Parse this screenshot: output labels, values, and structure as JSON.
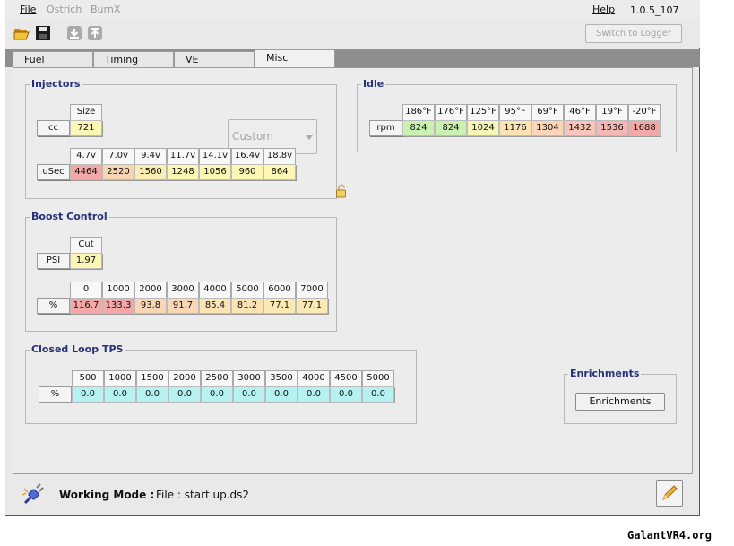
{
  "menubar": {
    "file": "File",
    "ostrich": "Ostrich",
    "burnx": "BurnX",
    "help": "Help",
    "version": "1.0.5_107"
  },
  "toolbar": {
    "switch_label": "Switch to Logger",
    "icons": [
      "open-folder-icon",
      "save-disk-icon",
      "download-icon",
      "upload-icon"
    ]
  },
  "tabs": [
    {
      "label": "Fuel",
      "active": false
    },
    {
      "label": "Timing",
      "active": false
    },
    {
      "label": "VE",
      "active": false
    },
    {
      "label": "Misc",
      "active": true
    }
  ],
  "injectors": {
    "title": "Injectors",
    "size_header": "Size",
    "cc_label": "cc",
    "size_value": "721",
    "dropdown_value": "Custom",
    "usec_label": "uSec",
    "voltages": [
      "4.7v",
      "7.0v",
      "9.4v",
      "11.7v",
      "14.1v",
      "16.4v",
      "18.8v"
    ],
    "values": [
      "4464",
      "2520",
      "1560",
      "1248",
      "1056",
      "960",
      "864"
    ],
    "colors": [
      "#f4a7a7",
      "#f8d5b2",
      "#fbeeb4",
      "#fcf7b4",
      "#fcf7b4",
      "#fcf7b4",
      "#fcf7b4"
    ]
  },
  "idle": {
    "title": "Idle",
    "row_label": "rpm",
    "temps": [
      "186°F",
      "176°F",
      "125°F",
      "95°F",
      "69°F",
      "46°F",
      "19°F",
      "-20°F"
    ],
    "values": [
      "824",
      "824",
      "1024",
      "1176",
      "1304",
      "1432",
      "1536",
      "1688"
    ],
    "colors": [
      "#c9f2b2",
      "#c9f2b2",
      "#f6f7b6",
      "#fbe3b4",
      "#fad5b7",
      "#f9c4b9",
      "#f7b7b7",
      "#f4a7a7"
    ]
  },
  "boost": {
    "title": "Boost Control",
    "cut_header": "Cut",
    "psi_label": "PSI",
    "psi_value": "1.97",
    "pct_label": "%",
    "rpms": [
      "0",
      "1000",
      "2000",
      "3000",
      "4000",
      "5000",
      "6000",
      "7000"
    ],
    "values": [
      "116.7",
      "133.3",
      "93.8",
      "91.7",
      "85.4",
      "81.2",
      "77.1",
      "77.1"
    ],
    "colors": [
      "#f4a7a7",
      "#f4a7a7",
      "#f9d6b6",
      "#fad8b5",
      "#fbe3b4",
      "#fbe3b4",
      "#fbeab4",
      "#fbeab4"
    ]
  },
  "closed_loop": {
    "title": "Closed Loop TPS",
    "pct_label": "%",
    "rpms": [
      "500",
      "1000",
      "1500",
      "2000",
      "2500",
      "3000",
      "3500",
      "4000",
      "4500",
      "5000"
    ],
    "values": [
      "0.0",
      "0.0",
      "0.0",
      "0.0",
      "0.0",
      "0.0",
      "0.0",
      "0.0",
      "0.0",
      "0.0"
    ],
    "color": "#b6f2f2"
  },
  "enrichments": {
    "title": "Enrichments",
    "button_label": "Enrichments"
  },
  "status": {
    "mode_label": "Working Mode :",
    "mode_value": "File : start up.ds2"
  },
  "watermark": "GalantVR4.org"
}
